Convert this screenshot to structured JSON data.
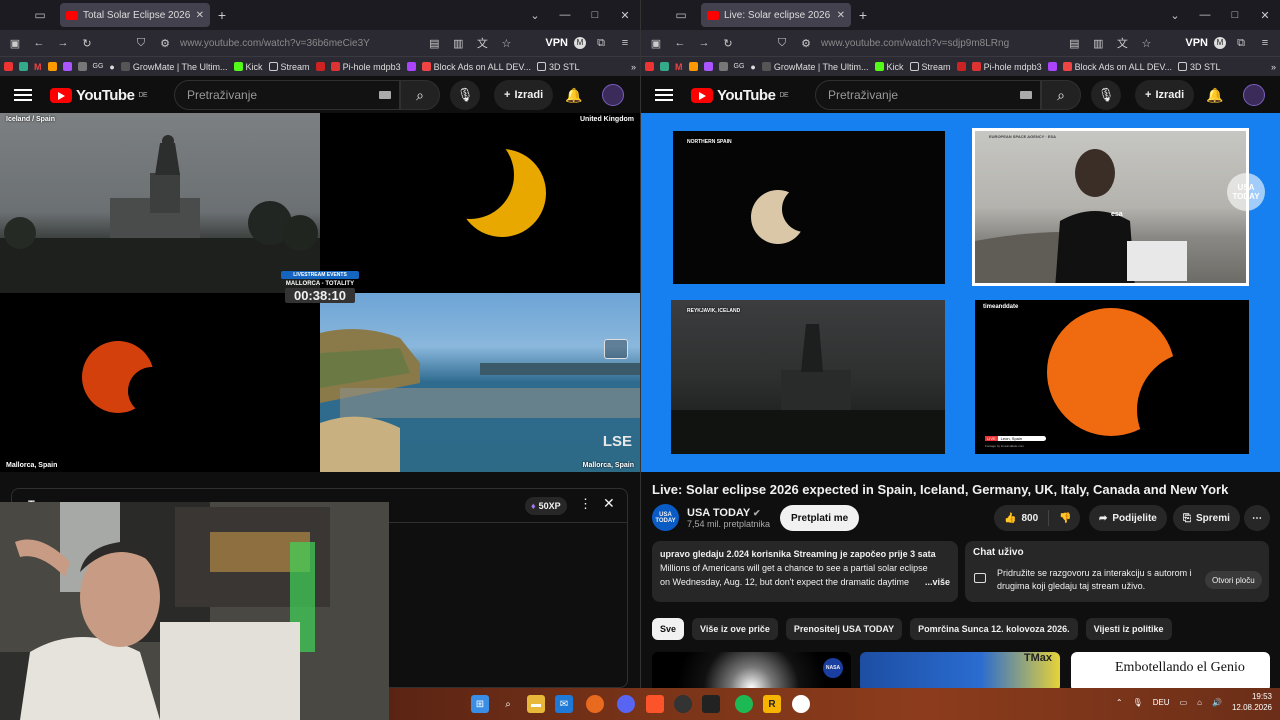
{
  "left": {
    "tab_title": "Total Solar Eclipse 2026 Live",
    "url": "www.youtube.com/watch?v=36b6meCie3Y",
    "vpn": "VPN",
    "bookmarks": [
      "GrowMate | The Ultim...",
      "Kick",
      "Stream",
      "Pi-hole mdpb3",
      "Block Ads on ALL DEV...",
      "3D STL"
    ],
    "search_placeholder": "Pretraživanje",
    "create_label": "Izradi",
    "logo": "YouTube",
    "logo_region": "DE",
    "video": {
      "label_iceland": "Iceland / Spain",
      "label_uk": "United Kingdom",
      "label_mallorca_left": "Mallorca, Spain",
      "label_mallorca_right": "Mallorca, Spain",
      "badge_top": "LIVESTREAM EVENTS",
      "badge_mid": "MALLORCA - TOTALITY",
      "countdown": "00:38:10",
      "lse": "LSE"
    },
    "panel": {
      "xp": "50XP",
      "partial_text": "T..."
    }
  },
  "right": {
    "tab_title": "Live: Solar eclipse 2026 expe...",
    "url": "www.youtube.com/watch?v=sdjp9m8LRng",
    "vpn": "VPN",
    "bookmarks": [
      "GrowMate | The Ultim...",
      "Kick",
      "Stream",
      "Pi-hole mdpb3",
      "Block Ads on ALL DEV...",
      "3D STL"
    ],
    "search_placeholder": "Pretraživanje",
    "create_label": "Izradi",
    "logo": "YouTube",
    "logo_region": "DE",
    "video": {
      "label_north_spain": "NORTHERN SPAIN",
      "label_reykjavik": "REYKJAVIK, ICELAND",
      "label_esa": "EUROPEAN SPACE AGENCY · ESA",
      "label_esa_logo": "esa",
      "label_timeanddate": "timeanddate",
      "label_leon": "Leon, Spain",
      "label_live": "LIVE",
      "label_footage": "Footage by timeanddate.com",
      "usa_today_badge": "USA TODAY"
    },
    "title": "Live: Solar eclipse 2026 expected in Spain, Iceland, Germany, UK, Italy, Canada and New York",
    "channel": {
      "name": "USA TODAY",
      "avatar_text": "USA TODAY",
      "subs": "7,54 mil. pretplatnika",
      "subscribe": "Pretplati me"
    },
    "likes": "800",
    "share": "Podijelite",
    "save": "Spremi",
    "description": {
      "line1": "upravo gledaju 2.024 korisnika  Streaming je započeo prije 3 sata",
      "line2": "Millions of Americans will get a chance to see a partial solar eclipse",
      "line3": "on Wednesday, Aug. 12, but don't expect the dramatic daytime",
      "more": "...više"
    },
    "chat": {
      "title": "Chat uživo",
      "body": "Pridružite se razgovoru za interakciju s autorom i drugima koji gledaju taj stream uživo.",
      "open": "Otvori ploču"
    },
    "chips": [
      "Sve",
      "Više iz ove priče",
      "Prenositelj USA TODAY",
      "Pomrčina Sunca 12. kolovoza 2026.",
      "Vijesti iz politike"
    ],
    "thumb_texts": {
      "tmax": "TMax",
      "emb": "Embotellando el Genio"
    }
  },
  "taskbar": {
    "lang": "DEU",
    "time": "19:53",
    "date": "12.08.2026"
  }
}
